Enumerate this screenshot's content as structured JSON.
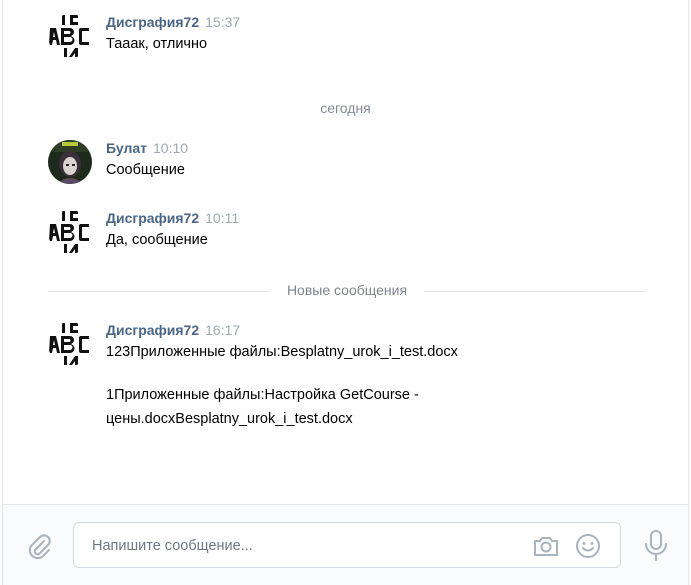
{
  "messages": [
    {
      "author": "Дисграфия72",
      "time": "15:37",
      "lines": [
        "Тааак, отлично"
      ]
    },
    {
      "author": "Булат",
      "time": "10:10",
      "lines": [
        "Сообщение"
      ]
    },
    {
      "author": "Дисграфия72",
      "time": "10:11",
      "lines": [
        "Да, сообщение"
      ]
    },
    {
      "author": "Дисграфия72",
      "time": "16:17",
      "lines": [
        "123Приложенные файлы:Besplatny_urok_i_test.docx",
        "1Приложенные файлы:Настройка GetCourse -",
        "цены.docxBesplatny_urok_i_test.docx"
      ]
    }
  ],
  "day_separator": "сегодня",
  "new_messages_label": "Новые сообщения",
  "composer": {
    "placeholder": "Напишите сообщение..."
  },
  "icons": {
    "attach": "paperclip-icon",
    "camera": "camera-icon",
    "emoji": "smile-icon",
    "voice": "microphone-icon"
  },
  "colors": {
    "author": "#4a6584",
    "time": "#a0a8b2",
    "icon": "#a9b3be"
  }
}
